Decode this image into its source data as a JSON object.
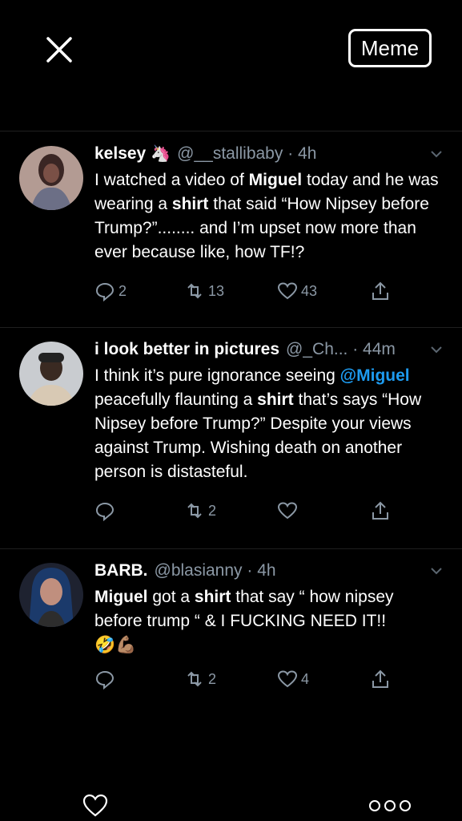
{
  "toolbar": {
    "meme_label": "Meme"
  },
  "tweets": [
    {
      "name": "kelsey",
      "handle_time": "@__stallibaby · 4h",
      "text_parts": [
        {
          "t": "I watched a video of ",
          "s": "n"
        },
        {
          "t": "Miguel",
          "s": "b"
        },
        {
          "t": " today and he was wearing a ",
          "s": "n"
        },
        {
          "t": "shirt",
          "s": "b"
        },
        {
          "t": " that said “How Nipsey before Trump?”........ and I’m upset now more than ever because like, how TF!?",
          "s": "n"
        }
      ],
      "replies": "2",
      "retweets": "13",
      "likes": "43",
      "avatar_color": "#6b4d4a"
    },
    {
      "name": "i look better in pictures",
      "handle_time": "@_Ch... · 44m",
      "text_parts": [
        {
          "t": "I think it’s pure ignorance seeing ",
          "s": "n"
        },
        {
          "t": "@Miguel",
          "s": "m"
        },
        {
          "t": " peacefully flaunting a ",
          "s": "n"
        },
        {
          "t": "shirt",
          "s": "b"
        },
        {
          "t": " that’s says “How Nipsey before Trump?” Despite your views against Trump. Wishing death on another person is distasteful.",
          "s": "n"
        }
      ],
      "replies": "",
      "retweets": "2",
      "likes": "",
      "avatar_color": "#8a8f95"
    },
    {
      "name": "BARB.",
      "handle_time": "@blasianny · 4h",
      "text_parts": [
        {
          "t": "Miguel",
          "s": "b"
        },
        {
          "t": " got a ",
          "s": "n"
        },
        {
          "t": "shirt",
          "s": "b"
        },
        {
          "t": " that say “ how nipsey before trump “ & I FUCKING NEED IT!!",
          "s": "n"
        }
      ],
      "emoji": "🤣💪🏽",
      "replies": "",
      "retweets": "2",
      "likes": "4",
      "avatar_color": "#2a2a3a"
    }
  ]
}
